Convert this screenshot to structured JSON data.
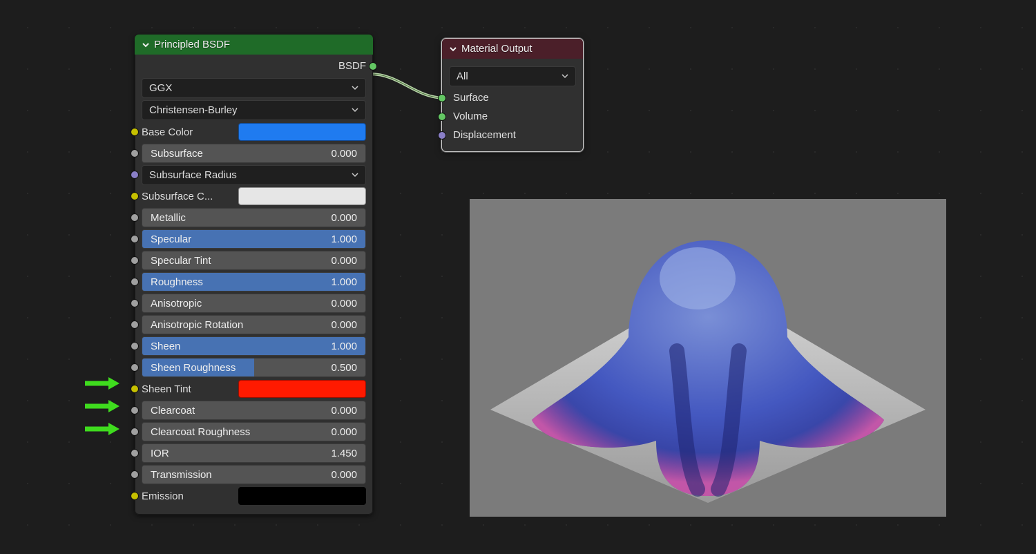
{
  "bsdf": {
    "title": "Principled BSDF",
    "output_label": "BSDF",
    "dropdown1": "GGX",
    "dropdown2": "Christensen-Burley",
    "base_color": {
      "label": "Base Color",
      "swatch": "#1f7bf0"
    },
    "subsurface": {
      "label": "Subsurface",
      "value": "0.000",
      "fill": 0
    },
    "sub_radius": {
      "label": "Subsurface Radius"
    },
    "sub_color": {
      "label": "Subsurface C...",
      "swatch": "#e6e6e6"
    },
    "metallic": {
      "label": "Metallic",
      "value": "0.000",
      "fill": 0
    },
    "specular": {
      "label": "Specular",
      "value": "1.000",
      "fill": 100
    },
    "spec_tint": {
      "label": "Specular Tint",
      "value": "0.000",
      "fill": 0
    },
    "roughness": {
      "label": "Roughness",
      "value": "1.000",
      "fill": 100
    },
    "anisotropic": {
      "label": "Anisotropic",
      "value": "0.000",
      "fill": 0
    },
    "aniso_rot": {
      "label": "Anisotropic Rotation",
      "value": "0.000",
      "fill": 0
    },
    "sheen": {
      "label": "Sheen",
      "value": "1.000",
      "fill": 100
    },
    "sheen_rough": {
      "label": "Sheen Roughness",
      "value": "0.500",
      "fill": 50
    },
    "sheen_tint": {
      "label": "Sheen Tint",
      "swatch": "#ff1a00"
    },
    "clearcoat": {
      "label": "Clearcoat",
      "value": "0.000",
      "fill": 0
    },
    "clearcoat_rough": {
      "label": "Clearcoat Roughness",
      "value": "0.000",
      "fill": 0
    },
    "ior": {
      "label": "IOR",
      "value": "1.450",
      "fill": 0
    },
    "transmission": {
      "label": "Transmission",
      "value": "0.000",
      "fill": 0
    },
    "emission": {
      "label": "Emission",
      "swatch": "#000000"
    }
  },
  "output": {
    "title": "Material Output",
    "dropdown": "All",
    "surface": "Surface",
    "volume": "Volume",
    "displacement": "Displacement"
  }
}
